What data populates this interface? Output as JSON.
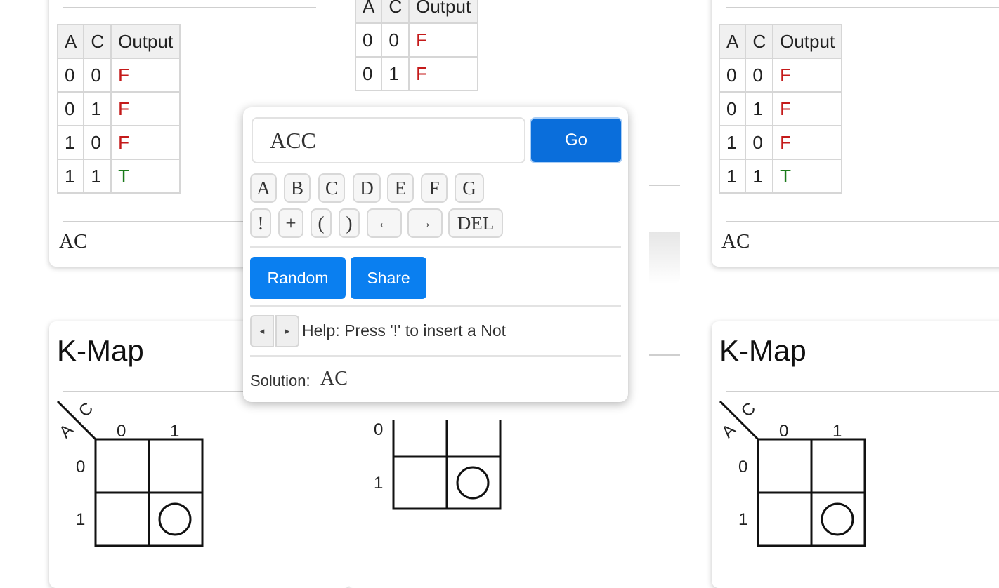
{
  "truth_table": {
    "headers": [
      "A",
      "C",
      "Output"
    ],
    "rows": [
      [
        "0",
        "0",
        "F"
      ],
      [
        "0",
        "1",
        "F"
      ],
      [
        "1",
        "0",
        "F"
      ],
      [
        "1",
        "1",
        "T"
      ]
    ]
  },
  "simplified_expression": "AC",
  "kmap": {
    "title": "K-Map",
    "row_var": "A",
    "col_var": "C",
    "col_labels": [
      "0",
      "1"
    ],
    "row_labels": [
      "0",
      "1"
    ],
    "circled_cell": "A=1,C=1"
  },
  "popup": {
    "input_value": "ACC",
    "go_label": "Go",
    "keys_row1": [
      "A",
      "B",
      "C",
      "D",
      "E",
      "F",
      "G"
    ],
    "keys_row2": [
      "!",
      "+",
      "(",
      ")",
      "←",
      "→",
      "DEL"
    ],
    "random_label": "Random",
    "share_label": "Share",
    "prev_glyph": "◂",
    "next_glyph": "▸",
    "help_text": "Help: Press '!' to insert a Not",
    "solution_label": "Solution:",
    "solution_value": "AC"
  },
  "colors": {
    "false": "#c41a1a",
    "true": "#1a7a1a",
    "accent": "#0a7ff0"
  }
}
